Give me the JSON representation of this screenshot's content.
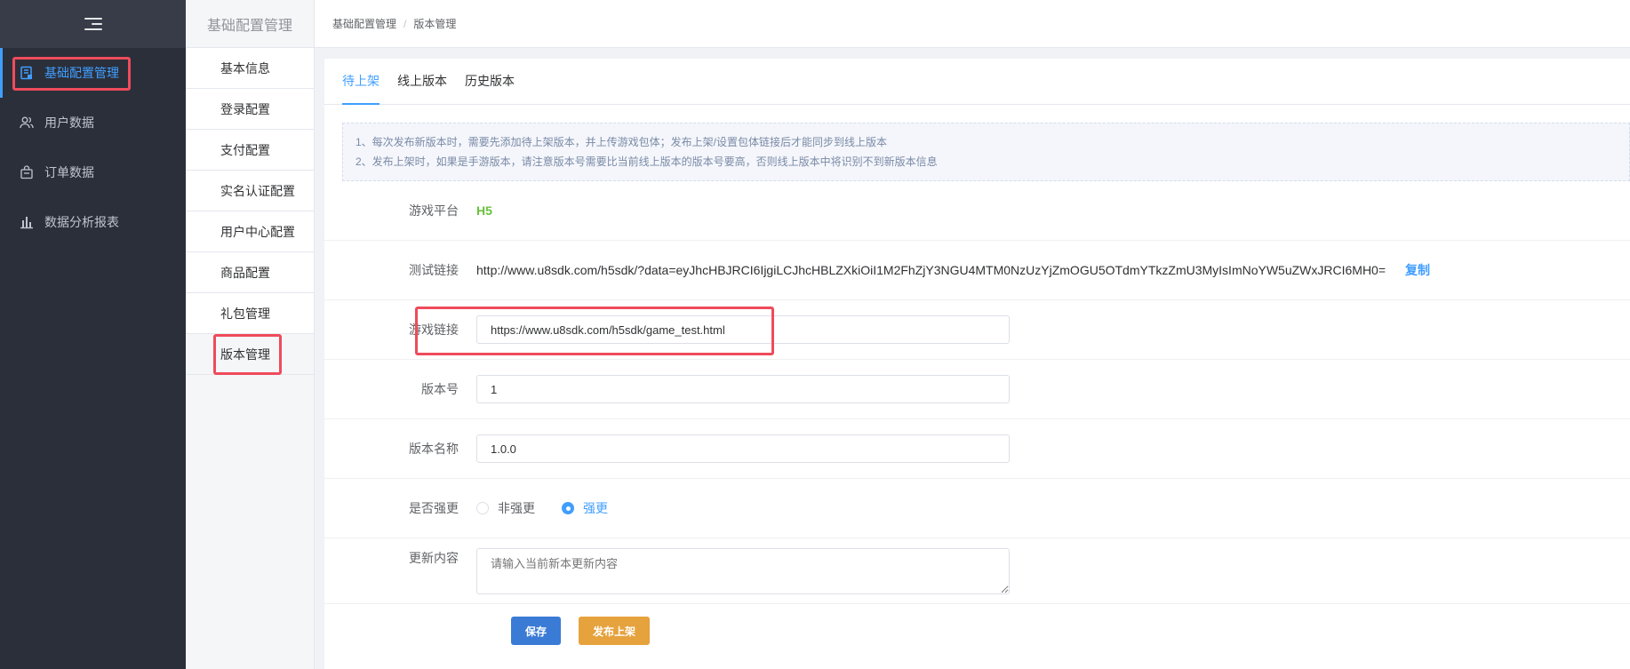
{
  "sidebar": {
    "toggle_icon": "menu-fold-icon",
    "items": [
      {
        "label": "基础配置管理",
        "icon": "document-config-icon",
        "active": true
      },
      {
        "label": "用户数据",
        "icon": "users-icon",
        "active": false
      },
      {
        "label": "订单数据",
        "icon": "shopping-bag-icon",
        "active": false
      },
      {
        "label": "数据分析报表",
        "icon": "bar-chart-icon",
        "active": false
      }
    ]
  },
  "submenu": {
    "title": "基础配置管理",
    "items": [
      {
        "label": "基本信息"
      },
      {
        "label": "登录配置"
      },
      {
        "label": "支付配置"
      },
      {
        "label": "实名认证配置"
      },
      {
        "label": "用户中心配置"
      },
      {
        "label": "商品配置"
      },
      {
        "label": "礼包管理"
      },
      {
        "label": "版本管理"
      }
    ],
    "active_index": 7
  },
  "breadcrumb": {
    "parent": "基础配置管理",
    "separator": "/",
    "current": "版本管理"
  },
  "tabs": [
    {
      "label": "待上架",
      "active": true
    },
    {
      "label": "线上版本",
      "active": false
    },
    {
      "label": "历史版本",
      "active": false
    }
  ],
  "notice": {
    "line1": "1、每次发布新版本时，需要先添加待上架版本，并上传游戏包体；发布上架/设置包体链接后才能同步到线上版本",
    "line2": "2、发布上架时，如果是手游版本，请注意版本号需要比当前线上版本的版本号要高，否则线上版本中将识别不到新版本信息"
  },
  "form": {
    "platform": {
      "label": "游戏平台",
      "value": "H5"
    },
    "test_link": {
      "label": "测试链接",
      "value": "http://www.u8sdk.com/h5sdk/?data=eyJhcHBJRCI6IjgiLCJhcHBLZXkiOiI1M2FhZjY3NGU4MTM0NzUzYjZmOGU5OTdmYTkzZmU3MyIsImNoYW5uZWxJRCI6MH0=",
      "copy_label": "复制"
    },
    "game_link": {
      "label": "游戏链接",
      "value": "https://www.u8sdk.com/h5sdk/game_test.html"
    },
    "version_code": {
      "label": "版本号",
      "value": "1"
    },
    "version_name": {
      "label": "版本名称",
      "value": "1.0.0"
    },
    "force_update": {
      "label": "是否强更",
      "options": [
        {
          "label": "非强更",
          "checked": false
        },
        {
          "label": "强更",
          "checked": true
        }
      ]
    },
    "update_content": {
      "label": "更新内容",
      "placeholder": "请输入当前新本更新内容"
    }
  },
  "buttons": {
    "save": "保存",
    "publish": "发布上架"
  },
  "colors": {
    "accent": "#409eff",
    "highlight_box": "#ef4b5b",
    "platform_value": "#67c23a",
    "save_button": "#3a7bd5",
    "publish_button": "#e6a23c",
    "sidebar_bg": "#2b2f3a"
  }
}
